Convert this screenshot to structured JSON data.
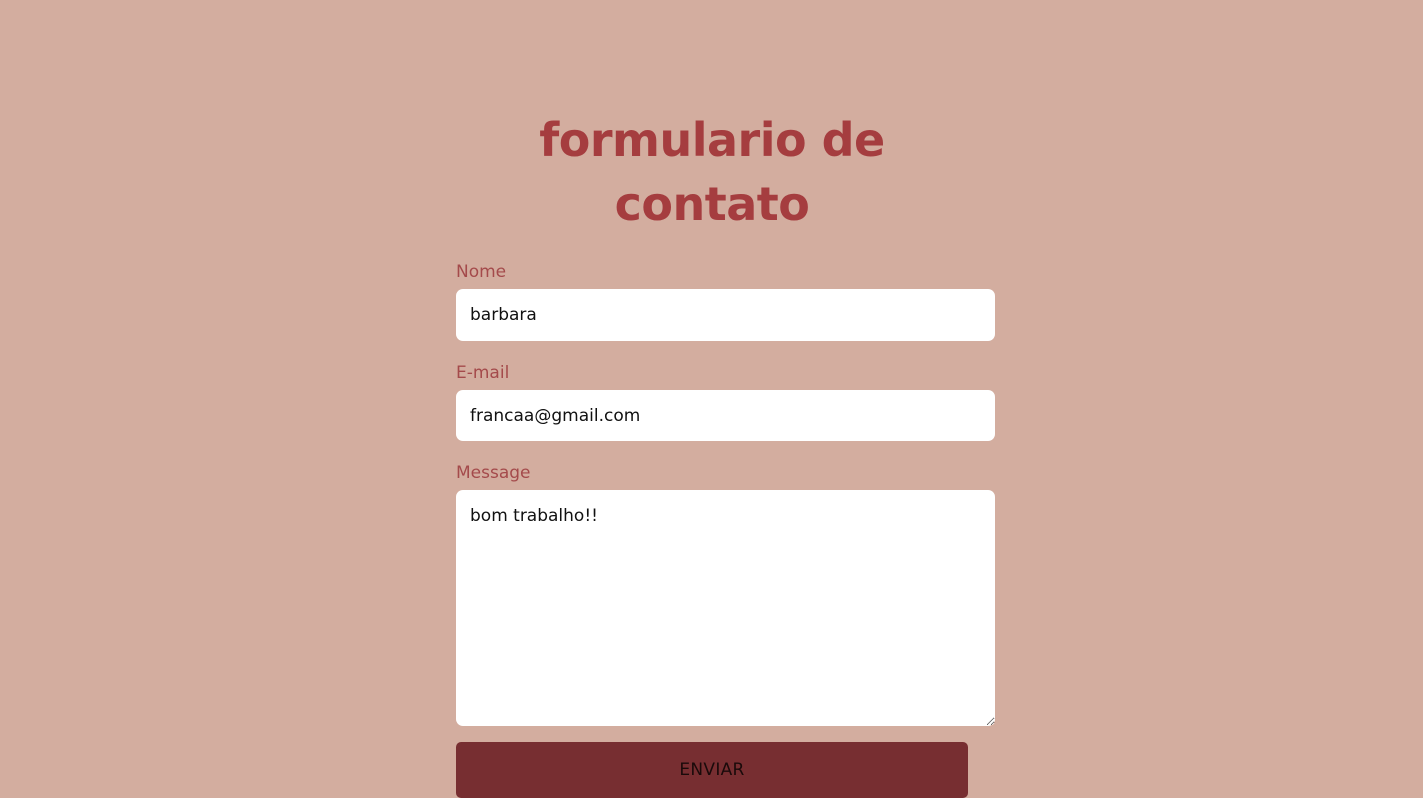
{
  "page": {
    "title": "formulario de contato"
  },
  "form": {
    "name": {
      "label": "Nome",
      "value": "barbara"
    },
    "email": {
      "label": "E-mail",
      "value": "francaa@gmail.com"
    },
    "message": {
      "label": "Message",
      "value": "bom trabalho!!"
    },
    "submit_label": "ENVIAR"
  },
  "colors": {
    "background": "#d3ad9f",
    "title": "#a53d3f",
    "label": "#a44a4b",
    "button": "#772e31"
  }
}
